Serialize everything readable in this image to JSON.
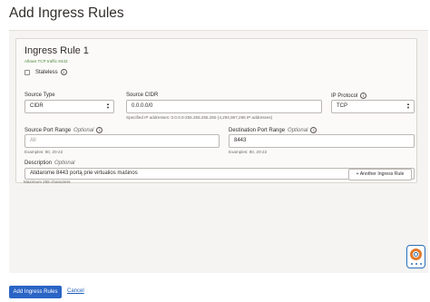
{
  "page": {
    "title": "Add Ingress Rules"
  },
  "rule": {
    "title": "Ingress Rule 1",
    "subtitle": "Allows TCP traffic 8443",
    "stateless": {
      "label": "Stateless",
      "checked": false
    },
    "source_type": {
      "label": "Source Type",
      "value": "CIDR"
    },
    "source_cidr": {
      "label": "Source CIDR",
      "value": "0.0.0.0/0",
      "hint": "Specified IP addresses: 0.0.0.0-255.255.255.255 (4,294,967,296 IP addresses)"
    },
    "ip_protocol": {
      "label": "IP Protocol",
      "value": "TCP"
    },
    "source_port": {
      "label": "Source Port Range",
      "optional": "Optional",
      "placeholder": "All",
      "hint": "Examples: 80, 20-22"
    },
    "dest_port": {
      "label": "Destination Port Range",
      "optional": "Optional",
      "value": "8443",
      "hint": "Examples: 80, 20-22"
    },
    "description": {
      "label": "Description",
      "optional": "Optional",
      "value": "Atidarome 8443 portą prie virtualios mašinos",
      "hint": "Maximum 255 characters"
    }
  },
  "actions": {
    "another_rule": "+ Another Ingress Rule",
    "submit": "Add Ingress Rules",
    "cancel": "Cancel"
  },
  "icons": {
    "info": "info-icon",
    "chevron": "chevron-up-down-icon",
    "help": "help-lifebuoy-icon"
  },
  "colors": {
    "primary": "#2a64c5",
    "subtitle_green": "#4f8b3b",
    "help_orange": "#e07a2e"
  }
}
